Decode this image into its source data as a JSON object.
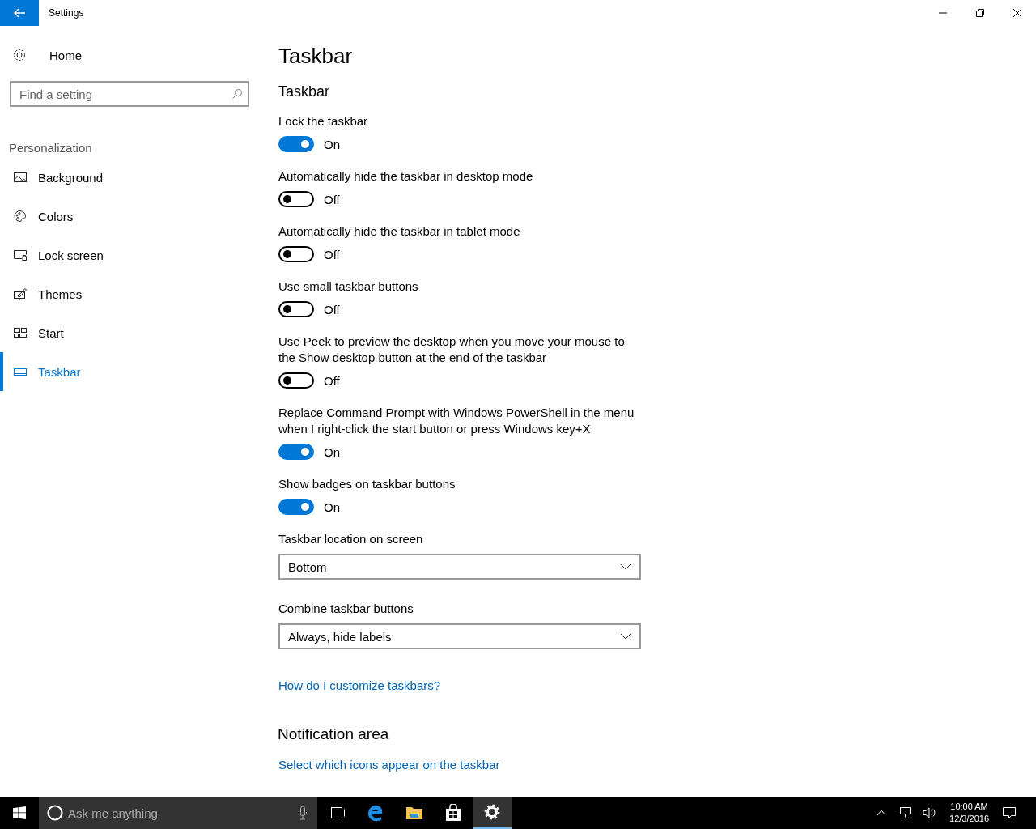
{
  "window": {
    "title": "Settings"
  },
  "sidebar": {
    "home": "Home",
    "search": {
      "placeholder": "Find a setting"
    },
    "group": "Personalization",
    "items": [
      {
        "label": "Background",
        "selected": false
      },
      {
        "label": "Colors",
        "selected": false
      },
      {
        "label": "Lock screen",
        "selected": false
      },
      {
        "label": "Themes",
        "selected": false
      },
      {
        "label": "Start",
        "selected": false
      },
      {
        "label": "Taskbar",
        "selected": true
      }
    ]
  },
  "page": {
    "title": "Taskbar",
    "section": "Taskbar",
    "settings": [
      {
        "kind": "toggle",
        "label": "Lock the taskbar",
        "on": true,
        "state_text": "On"
      },
      {
        "kind": "toggle",
        "label": "Automatically hide the taskbar in desktop mode",
        "on": false,
        "state_text": "Off"
      },
      {
        "kind": "toggle",
        "label": "Automatically hide the taskbar in tablet mode",
        "on": false,
        "state_text": "Off"
      },
      {
        "kind": "toggle",
        "label": "Use small taskbar buttons",
        "on": false,
        "state_text": "Off"
      },
      {
        "kind": "toggle",
        "label": "Use Peek to preview the desktop when you move your mouse to the Show desktop button at the end of the taskbar",
        "on": false,
        "state_text": "Off"
      },
      {
        "kind": "toggle",
        "label": "Replace Command Prompt with Windows PowerShell in the menu when I right-click the start button or press Windows key+X",
        "on": true,
        "state_text": "On"
      },
      {
        "kind": "toggle",
        "label": "Show badges on taskbar buttons",
        "on": true,
        "state_text": "On"
      },
      {
        "kind": "dropdown",
        "label": "Taskbar location on screen",
        "value": "Bottom"
      },
      {
        "kind": "dropdown",
        "label": "Combine taskbar buttons",
        "value": "Always, hide labels"
      }
    ],
    "help_link": "How do I customize taskbars?",
    "notification_heading": "Notification area",
    "notification_link": "Select which icons appear on the taskbar"
  },
  "taskbar": {
    "search": {
      "placeholder": "Ask me anything"
    },
    "apps": [
      {
        "selected": false
      },
      {
        "selected": false
      },
      {
        "selected": false
      },
      {
        "selected": false
      },
      {
        "selected": true
      }
    ],
    "time": "10:00 AM",
    "date": "12/3/2016"
  }
}
